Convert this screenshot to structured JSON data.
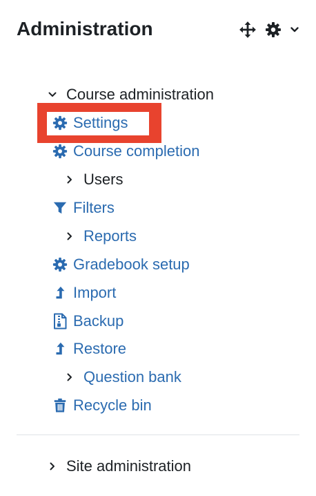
{
  "header": {
    "title": "Administration"
  },
  "header_icons": [
    "move-icon",
    "gear-icon",
    "chevron-down-icon"
  ],
  "tree": {
    "course_admin": "Course administration",
    "settings": "Settings",
    "course_completion": "Course completion",
    "users": "Users",
    "filters": "Filters",
    "reports": "Reports",
    "gradebook_setup": "Gradebook setup",
    "import": "Import",
    "backup": "Backup",
    "restore": "Restore",
    "question_bank": "Question bank",
    "recycle_bin": "Recycle bin",
    "site_admin": "Site administration"
  },
  "colors": {
    "link": "#2b6bb0",
    "text": "#1d2125",
    "highlight": "#e8432e",
    "divider": "#dee2e6"
  }
}
